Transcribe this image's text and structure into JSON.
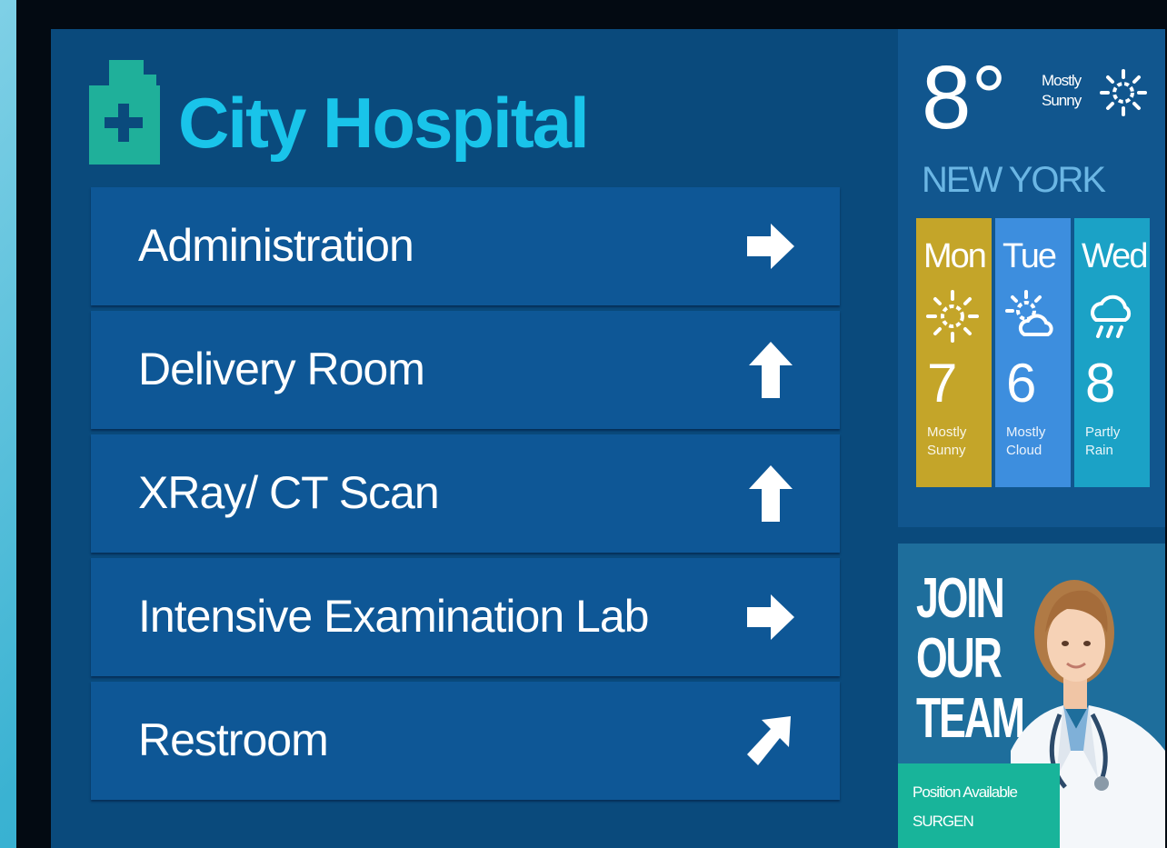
{
  "header": {
    "title": "City Hospital",
    "logo_icon": "hospital-cross-icon"
  },
  "menu": {
    "items": [
      {
        "label": "Administration",
        "direction": "right"
      },
      {
        "label": "Delivery Room",
        "direction": "up"
      },
      {
        "label": "XRay/ CT Scan",
        "direction": "up"
      },
      {
        "label": "Intensive Examination Lab",
        "direction": "right"
      },
      {
        "label": "Restroom",
        "direction": "up-right"
      }
    ]
  },
  "weather": {
    "current_temp": "8°",
    "condition": "Mostly Sunny",
    "condition_icon": "sun-icon",
    "city": "NEW YORK",
    "forecast": [
      {
        "day": "Mon",
        "temp": "7",
        "desc": "Mostly Sunny",
        "icon": "sun-icon",
        "color": "#c4a529"
      },
      {
        "day": "Tue",
        "temp": "6",
        "desc": "Mostly Cloud",
        "icon": "sun-cloud-icon",
        "color": "#3d8ede"
      },
      {
        "day": "Wed",
        "temp": "8",
        "desc": "Partly Rain",
        "icon": "rain-icon",
        "color": "#1ba2c6"
      }
    ]
  },
  "join": {
    "title": "JOIN OUR TEAM",
    "position_label": "Position Available",
    "position_value": "SURGEN"
  },
  "colors": {
    "screen_bg": "#0a4a7c",
    "menu_item_bg": "#0e5796",
    "title_accent": "#19c4ea",
    "logo_green": "#1fb09a"
  }
}
